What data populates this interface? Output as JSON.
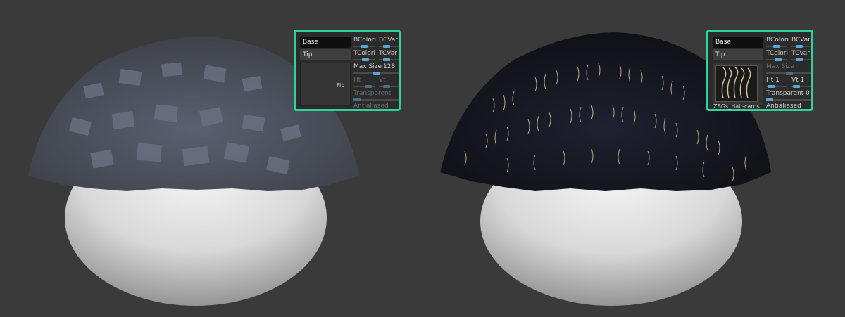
{
  "scene": {
    "left_render": "shaded hair cards on sphere",
    "right_render": "textured hair cards on sphere"
  },
  "panel_left": {
    "tabs": {
      "base": "Base",
      "tip": "Tip"
    },
    "thumb_label": "Fib",
    "controls": {
      "bcolor": "BColori",
      "bcvar": "BCVar",
      "tcolor": "TColori",
      "tcvar": "TCVar",
      "max_size": "Max Size",
      "max_size_value": "128",
      "ht": "Ht",
      "vt": "Vt",
      "transparent": "Transparent",
      "antialiased": "Antialiased"
    }
  },
  "panel_right": {
    "tabs": {
      "base": "Base",
      "tip": "Tip"
    },
    "thumb_name": "ZBGs_Hair-cards",
    "controls": {
      "bcolor": "BColori",
      "bcvar": "BCVar",
      "tcolor": "TColori",
      "tcvar": "TCVar",
      "max_size": "Max Size",
      "ht": "Ht 1",
      "vt": "Vt 1",
      "transparent": "Transparent 0",
      "antialiased": "Antialiased"
    }
  },
  "colors": {
    "background": "#3a3a3a",
    "panel_border": "#2ed39a",
    "slider_knob": "#5aa7d6"
  }
}
